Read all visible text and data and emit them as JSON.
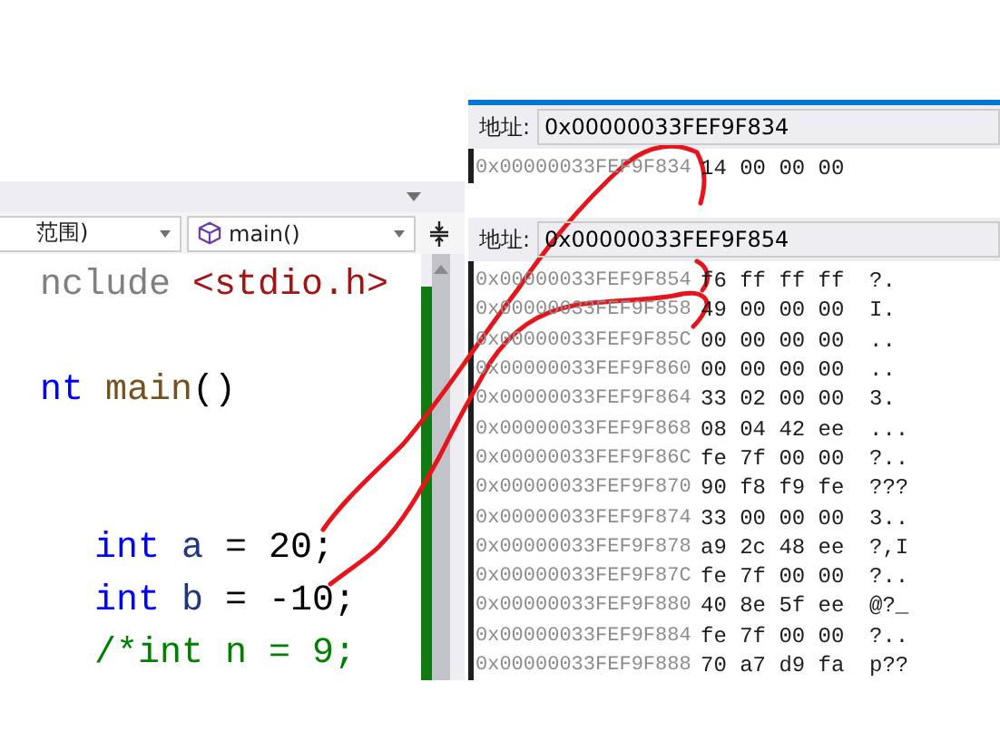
{
  "editor": {
    "scope_dropdown": "范围)",
    "function_dropdown": "main()",
    "code_lines": [
      {
        "kind": "code",
        "indented": false,
        "tokens": [
          {
            "kind": "preprocessor",
            "text": "nclude "
          },
          {
            "kind": "header",
            "text": "<stdio.h>"
          }
        ]
      },
      {
        "kind": "blank"
      },
      {
        "kind": "code",
        "indented": false,
        "tokens": [
          {
            "kind": "keyword",
            "text": "nt "
          },
          {
            "kind": "function",
            "text": "main"
          },
          {
            "kind": "plain",
            "text": "()"
          }
        ]
      },
      {
        "kind": "blank"
      },
      {
        "kind": "blank"
      },
      {
        "kind": "code",
        "indented": true,
        "tokens": [
          {
            "kind": "keyword",
            "text": "int "
          },
          {
            "kind": "variable",
            "text": "a"
          },
          {
            "kind": "plain",
            "text": " = 20;"
          }
        ]
      },
      {
        "kind": "code",
        "indented": true,
        "tokens": [
          {
            "kind": "keyword",
            "text": "int "
          },
          {
            "kind": "variable",
            "text": "b"
          },
          {
            "kind": "plain",
            "text": " = -10;"
          }
        ]
      },
      {
        "kind": "code",
        "indented": true,
        "tokens": [
          {
            "kind": "comment",
            "text": "/*int n = 9;"
          }
        ]
      }
    ]
  },
  "memory_windows": [
    {
      "address_label": "地址:",
      "address": "0x00000033FEF9F834",
      "rows": [
        {
          "address": "0x00000033FEF9F834",
          "bytes": [
            "14",
            "00",
            "00",
            "00"
          ]
        }
      ]
    },
    {
      "address_label": "地址:",
      "address": "0x00000033FEF9F854",
      "rows": [
        {
          "address": "0x00000033FEF9F854",
          "bytes": [
            "f6",
            "ff",
            "ff",
            "ff"
          ],
          "ascii": "?."
        },
        {
          "address": "0x00000033FEF9F858",
          "bytes": [
            "49",
            "00",
            "00",
            "00"
          ],
          "ascii": "I."
        },
        {
          "address": "0x00000033FEF9F85C",
          "bytes": [
            "00",
            "00",
            "00",
            "00"
          ],
          "ascii": ".."
        },
        {
          "address": "0x00000033FEF9F860",
          "bytes": [
            "00",
            "00",
            "00",
            "00"
          ],
          "ascii": ".."
        },
        {
          "address": "0x00000033FEF9F864",
          "bytes": [
            "33",
            "02",
            "00",
            "00"
          ],
          "ascii": "3."
        },
        {
          "address": "0x00000033FEF9F868",
          "bytes": [
            "08",
            "04",
            "42",
            "ee"
          ],
          "ascii": "..."
        },
        {
          "address": "0x00000033FEF9F86C",
          "bytes": [
            "fe",
            "7f",
            "00",
            "00"
          ],
          "ascii": "?.."
        },
        {
          "address": "0x00000033FEF9F870",
          "bytes": [
            "90",
            "f8",
            "f9",
            "fe"
          ],
          "ascii": "???"
        },
        {
          "address": "0x00000033FEF9F874",
          "bytes": [
            "33",
            "00",
            "00",
            "00"
          ],
          "ascii": "3.."
        },
        {
          "address": "0x00000033FEF9F878",
          "bytes": [
            "a9",
            "2c",
            "48",
            "ee"
          ],
          "ascii": "?,I"
        },
        {
          "address": "0x00000033FEF9F87C",
          "bytes": [
            "fe",
            "7f",
            "00",
            "00"
          ],
          "ascii": "?.."
        },
        {
          "address": "0x00000033FEF9F880",
          "bytes": [
            "40",
            "8e",
            "5f",
            "ee"
          ],
          "ascii": "@?_"
        },
        {
          "address": "0x00000033FEF9F884",
          "bytes": [
            "fe",
            "7f",
            "00",
            "00"
          ],
          "ascii": "?.."
        },
        {
          "address": "0x00000033FEF9F888",
          "bytes": [
            "70",
            "a7",
            "d9",
            "fa"
          ],
          "ascii": "p??"
        }
      ]
    }
  ]
}
